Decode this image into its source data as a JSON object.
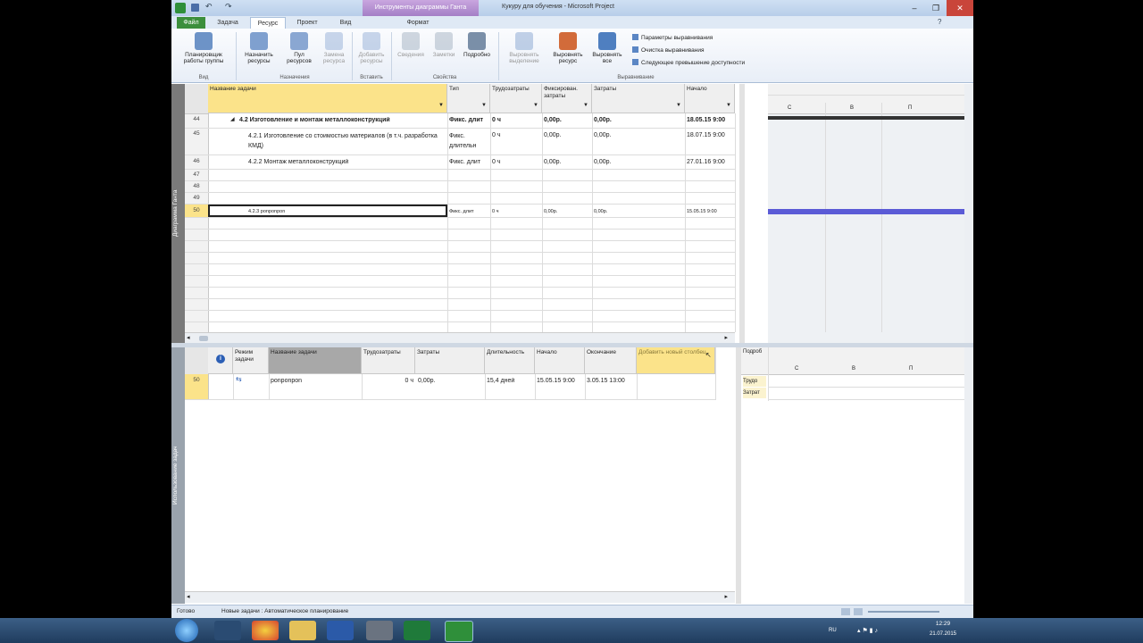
{
  "window": {
    "title": "Кукуру для обучения - Microsoft Project",
    "context_tab": "Инструменты диаграммы Ганта"
  },
  "tabs": [
    {
      "label": "Файл"
    },
    {
      "label": "Задача"
    },
    {
      "label": "Ресурс"
    },
    {
      "label": "Проект"
    },
    {
      "label": "Вид"
    },
    {
      "label": "Формат"
    }
  ],
  "ribbon": {
    "plan": "Планировщик работы группы",
    "assign": "Назначить ресурсы",
    "pool": "Пул ресурсов",
    "replace": "Замена ресурса",
    "add": "Добавить ресурсы",
    "info": "Сведения",
    "notes": "Заметки",
    "details": "Подробно",
    "level_sel": "Выровнять выделение",
    "level_res": "Выровнять ресурс",
    "level_all": "Выровнять все",
    "opt_level": "Параметры выравнивания",
    "opt_clear": "Очистка выравнивания",
    "opt_next": "Следующее превышение доступности",
    "groups": {
      "view": "Вид",
      "assignments": "Назначения",
      "insert": "Вставить",
      "properties": "Свойства",
      "leveling": "Выравнивание"
    }
  },
  "top_table": {
    "side_label": "Диаграмма Ганта",
    "headers": [
      "Название задачи",
      "Тип",
      "Трудозатраты",
      "Фиксирован. затраты",
      "Затраты",
      "Начало"
    ],
    "rows": [
      {
        "id": "44",
        "name": "4.2 Изготовление и монтаж металлоконструкций",
        "type": "Фикс. длит",
        "work": "0 ч",
        "fixed": "0,00р.",
        "cost": "0,00р.",
        "start": "18.05.15 9:00"
      },
      {
        "id": "45",
        "name": "4.2.1 Изготовление со стоимостью материалов (в т.ч. разработка КМД)",
        "type": "Фикс. длительн",
        "work": "0 ч",
        "fixed": "0,00р.",
        "cost": "0,00р.",
        "start": "18.07.15 9:00"
      },
      {
        "id": "46",
        "name": "4.2.2 Монтаж металлоконструкций",
        "type": "Фикс. длит",
        "work": "0 ч",
        "fixed": "0,00р.",
        "cost": "0,00р.",
        "start": "27.01.16 9:00"
      },
      {
        "id": "47",
        "name": "",
        "type": "",
        "work": "",
        "fixed": "",
        "cost": "",
        "start": ""
      },
      {
        "id": "48",
        "name": "",
        "type": "",
        "work": "",
        "fixed": "",
        "cost": "",
        "start": ""
      },
      {
        "id": "49",
        "name": "",
        "type": "",
        "work": "",
        "fixed": "",
        "cost": "",
        "start": ""
      },
      {
        "id": "50",
        "name": "4.2.3 ponponpon",
        "type": "Фикс. длит",
        "work": "0 ч",
        "fixed": "0,00р.",
        "cost": "0,00р.",
        "start": "15.05.15 9:00"
      }
    ]
  },
  "gantt_days": [
    "С",
    "В",
    "П"
  ],
  "bottom_table": {
    "side_label": "Использование задач",
    "headers": [
      "",
      "Режим задачи",
      "Название задачи",
      "Трудозатраты",
      "Затраты",
      "Длительность",
      "Начало",
      "Окончание",
      "Добавить новый столбец"
    ],
    "row": {
      "id": "50",
      "name": "ponponpon",
      "work": "0 ч",
      "cost": "0,00р.",
      "duration": "15,4 дней",
      "start": "15.05.15 9:00",
      "finish": "3.05.15 13:00"
    }
  },
  "usage_panel": {
    "details": "Подроб",
    "rows": [
      "Трудо",
      "Затрат"
    ],
    "days": [
      "С",
      "В",
      "П"
    ]
  },
  "status": {
    "ready": "Готово",
    "mode": "Новые задачи : Автоматическое планирование"
  },
  "tray": {
    "lang": "RU",
    "time": "12:29",
    "date": "21.07.2015"
  },
  "colors": {
    "selected_header": "#fbe38a",
    "gantt_bar": "#5b5bd6",
    "file_tab": "#3c8f3c"
  }
}
